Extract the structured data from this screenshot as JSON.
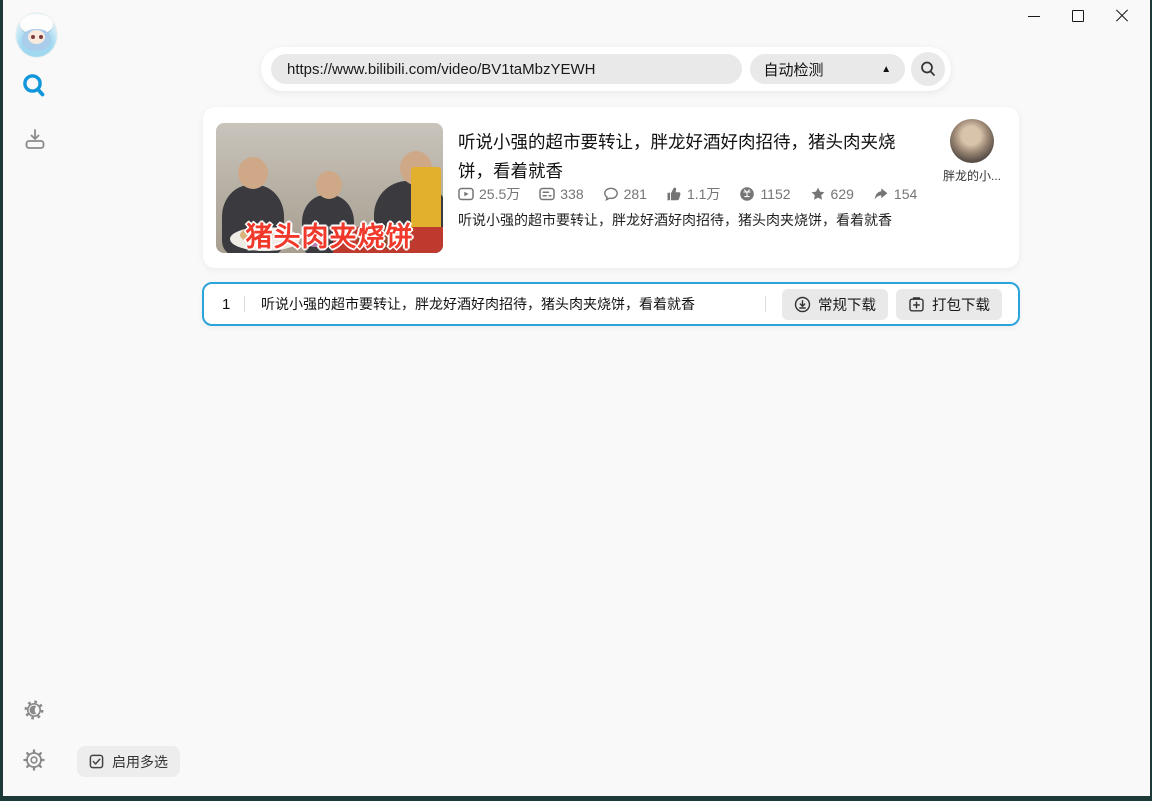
{
  "search": {
    "url_value": "https://www.bilibili.com/video/BV1taMbzYEWH",
    "detect_selected": "自动检测"
  },
  "video_card": {
    "title": "听说小强的超市要转让，胖龙好酒好肉招待，猪头肉夹烧饼，看着就香",
    "thumbnail_overlay_text": "猪头肉夹烧饼",
    "description": "听说小强的超市要转让，胖龙好酒好肉招待，猪头肉夹烧饼，看着就香",
    "uploader_name": "胖龙的小...",
    "stats": [
      {
        "icon": "play-count-icon",
        "value": "25.5万"
      },
      {
        "icon": "danmaku-icon",
        "value": "338"
      },
      {
        "icon": "comment-icon",
        "value": "281"
      },
      {
        "icon": "like-icon",
        "value": "1.1万"
      },
      {
        "icon": "coin-icon",
        "value": "1152"
      },
      {
        "icon": "favorite-icon",
        "value": "629"
      },
      {
        "icon": "share-icon",
        "value": "154"
      }
    ]
  },
  "download_row": {
    "index": "1",
    "title": "听说小强的超市要转让，胖龙好酒好肉招待，猪头肉夹烧饼，看着就香",
    "regular_button": "常规下载",
    "package_button": "打包下载"
  },
  "footer": {
    "multi_select_label": "启用多选"
  },
  "icons": {
    "dropdown_arrow": "▲",
    "sidebar": [
      "search-icon",
      "download-icon",
      "theme-icon",
      "settings-icon"
    ],
    "stat_icons": [
      "play-count-icon",
      "danmaku-icon",
      "comment-icon",
      "like-icon",
      "coin-icon",
      "favorite-icon",
      "share-icon"
    ]
  },
  "colors": {
    "accent_blue": "#1296db",
    "row_border_blue": "#2ba3dc",
    "window_border_teal": "#1d3a38",
    "thumb_text_red": "#f0392b",
    "input_gray": "#e9e9e9"
  }
}
